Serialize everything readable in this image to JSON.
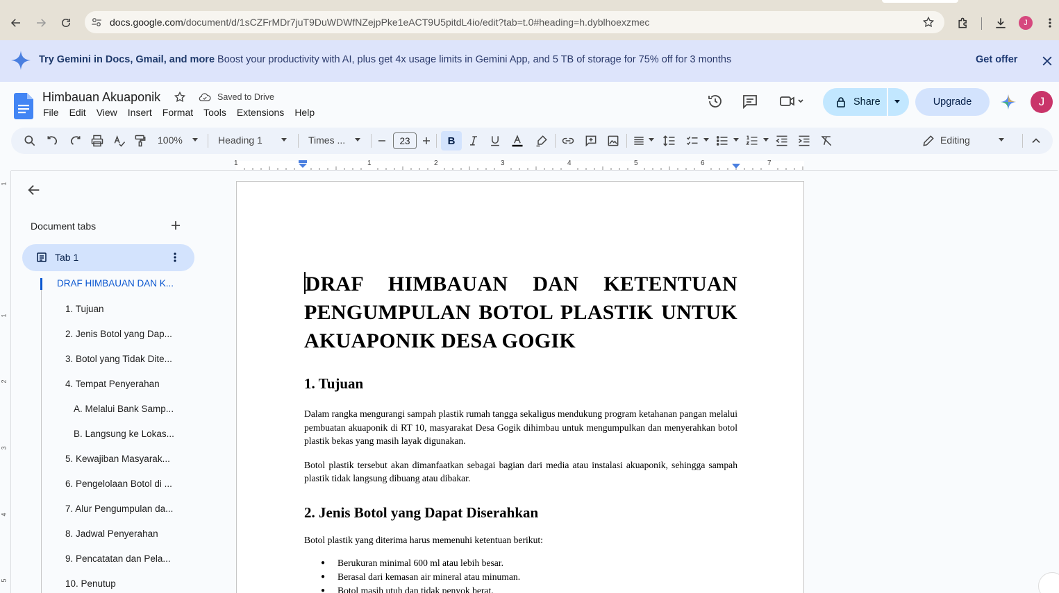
{
  "browser": {
    "url_host": "docs.google.com",
    "url_path": "/document/d/1sCZFrMDr7juT9DuWDWfNZejpPke1eACT9U5pitdL4io/edit?tab=t.0#heading=h.dyblhoexzmec",
    "profile_initial": "J"
  },
  "banner": {
    "headline": "Try Gemini in Docs, Gmail, and more",
    "body": "Boost your productivity with AI, plus get 4x usage limits in Gemini App, and 5 TB of storage for 75% off for 3 months",
    "cta": "Get offer"
  },
  "header": {
    "title": "Himbauan Akuaponik",
    "save_status": "Saved to Drive",
    "menu": [
      "File",
      "Edit",
      "View",
      "Insert",
      "Format",
      "Tools",
      "Extensions",
      "Help"
    ],
    "share_label": "Share",
    "upgrade_label": "Upgrade",
    "user_initial": "J"
  },
  "toolbar": {
    "zoom": "100%",
    "style": "Heading 1",
    "font": "Times ...",
    "font_size": "23",
    "bold": "B",
    "mode": "Editing"
  },
  "ruler": {
    "labels": [
      "1",
      "1",
      "2",
      "3",
      "4",
      "5",
      "6",
      "7"
    ]
  },
  "vertical_ruler": {
    "labels": [
      "1",
      "1",
      "2",
      "3",
      "4",
      "5"
    ]
  },
  "sidebar": {
    "title": "Document tabs",
    "tab_name": "Tab 1",
    "outline": [
      {
        "label": "DRAF HIMBAUAN DAN K...",
        "level": 0,
        "active": true
      },
      {
        "label": "1. Tujuan",
        "level": 1
      },
      {
        "label": "2. Jenis Botol yang Dap...",
        "level": 1
      },
      {
        "label": "3. Botol yang Tidak Dite...",
        "level": 1
      },
      {
        "label": "4. Tempat Penyerahan",
        "level": 1
      },
      {
        "label": "A. Melalui Bank Samp...",
        "level": 2
      },
      {
        "label": "B. Langsung ke Lokas...",
        "level": 2
      },
      {
        "label": "5. Kewajiban Masyarak...",
        "level": 1
      },
      {
        "label": "6. Pengelolaan Botol di ...",
        "level": 1
      },
      {
        "label": "7. Alur Pengumpulan da...",
        "level": 1
      },
      {
        "label": "8. Jadwal Penyerahan",
        "level": 1
      },
      {
        "label": "9. Pencatatan dan Pela...",
        "level": 1
      },
      {
        "label": "10. Penutup",
        "level": 1
      }
    ]
  },
  "document": {
    "title": "DRAF HIMBAUAN DAN KETENTUAN PENGUMPULAN BOTOL PLASTIK UNTUK AKUAPONIK DESA GOGIK",
    "section1_heading": "1. Tujuan",
    "section1_p1": "Dalam rangka mengurangi sampah plastik rumah tangga sekaligus mendukung program ketahanan pangan melalui pembuatan akuaponik di RT 10, masyarakat Desa Gogik dihimbau untuk mengumpulkan dan menyerahkan botol plastik bekas yang masih layak digunakan.",
    "section1_p2": "Botol plastik tersebut akan dimanfaatkan sebagai bagian dari media atau instalasi akuaponik, sehingga sampah plastik tidak langsung dibuang atau dibakar.",
    "section2_heading": "2. Jenis Botol yang Dapat Diserahkan",
    "section2_intro": "Botol plastik yang diterima harus memenuhi ketentuan berikut:",
    "section2_items": [
      "Berukuran minimal 600 ml atau lebih besar.",
      "Berasal dari kemasan air mineral atau minuman.",
      "Botol masih utuh dan tidak penyok berat."
    ]
  }
}
